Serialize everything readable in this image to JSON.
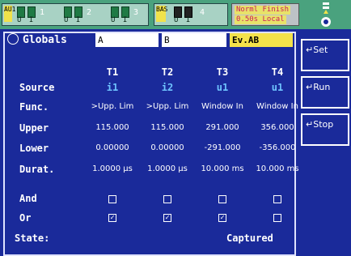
{
  "topbar": {
    "group1": {
      "tag": "AU1",
      "elements": [
        "1",
        "2",
        "3"
      ],
      "ui": [
        "U I",
        "U I",
        "U I"
      ]
    },
    "group2": {
      "tag": "BAS",
      "element": "4",
      "ui": "U I"
    },
    "status": {
      "line1": "Norml Finish",
      "line2": "0.50s Local"
    }
  },
  "tabs": {
    "globals": "Globals",
    "a": "A",
    "b": "B",
    "ev": "Ev.AB"
  },
  "columns": [
    "T1",
    "T2",
    "T3",
    "T4"
  ],
  "rows": {
    "source": {
      "label": "Source",
      "values": [
        "i1",
        "i2",
        "u1",
        "u1"
      ]
    },
    "func": {
      "label": "Func.",
      "values": [
        ">Upp. Lim",
        ">Upp. Lim",
        "Window In",
        "Window In"
      ]
    },
    "upper": {
      "label": "Upper",
      "values": [
        "115.000",
        "115.000",
        "291.000",
        "356.000"
      ]
    },
    "lower": {
      "label": "Lower",
      "values": [
        "0.00000",
        "0.00000",
        "-291.000",
        "-356.000"
      ]
    },
    "durat": {
      "label": "Durat.",
      "values": [
        "1.0000 µs",
        "1.0000 µs",
        "10.000 ms",
        "10.000 ms"
      ]
    },
    "and": {
      "label": "And",
      "checked": [
        false,
        false,
        false,
        false
      ]
    },
    "or": {
      "label": "Or",
      "checked": [
        true,
        true,
        true,
        false
      ]
    }
  },
  "state": {
    "label": "State:",
    "value": "Captured"
  },
  "side_buttons": {
    "set": "Set",
    "run": "Run",
    "stop": "Stop"
  },
  "colors": {
    "background": "#1a2a9a",
    "source_text": "#6fc4ff",
    "active_tab": "#f4e34a",
    "status_text": "#cc1d5a"
  }
}
